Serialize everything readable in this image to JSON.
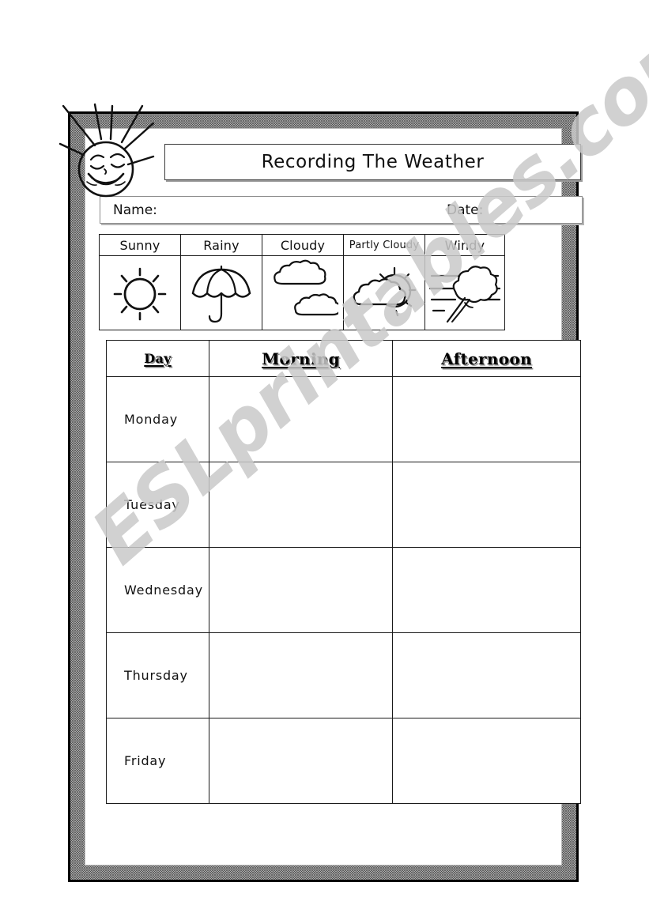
{
  "document": {
    "title": "Recording The Weather",
    "type": "worksheet"
  },
  "header": {
    "title": "Recording The Weather",
    "mascot_icon": "smiling-sun-icon"
  },
  "name_date_row": {
    "name_label": "Name:",
    "date_label": "Date:"
  },
  "weather_key": {
    "columns": [
      {
        "label": "Sunny",
        "icon": "sun-icon",
        "small_label": false
      },
      {
        "label": "Rainy",
        "icon": "umbrella-icon",
        "small_label": false
      },
      {
        "label": "Cloudy",
        "icon": "clouds-icon",
        "small_label": false
      },
      {
        "label": "Partly Cloudy",
        "icon": "sun-behind-cloud-icon",
        "small_label": true
      },
      {
        "label": "Windy",
        "icon": "windy-tree-icon",
        "small_label": false
      }
    ]
  },
  "record_table": {
    "headers": [
      "Day",
      "Morning",
      "Afternoon"
    ],
    "rows": [
      {
        "day": "Monday",
        "morning": "",
        "afternoon": ""
      },
      {
        "day": "Tuesday",
        "morning": "",
        "afternoon": ""
      },
      {
        "day": "Wednesday",
        "morning": "",
        "afternoon": ""
      },
      {
        "day": "Thursday",
        "morning": "",
        "afternoon": ""
      },
      {
        "day": "Friday",
        "morning": "",
        "afternoon": ""
      }
    ]
  },
  "watermark": {
    "text": "ESLprintables.com",
    "color": "#c9c9c9"
  },
  "colors": {
    "ink": "#111111",
    "rule": "#1a1a1a",
    "frame_dot": "#4a4a4a",
    "shadow": "#8a8a8a",
    "paper": "#ffffff"
  }
}
